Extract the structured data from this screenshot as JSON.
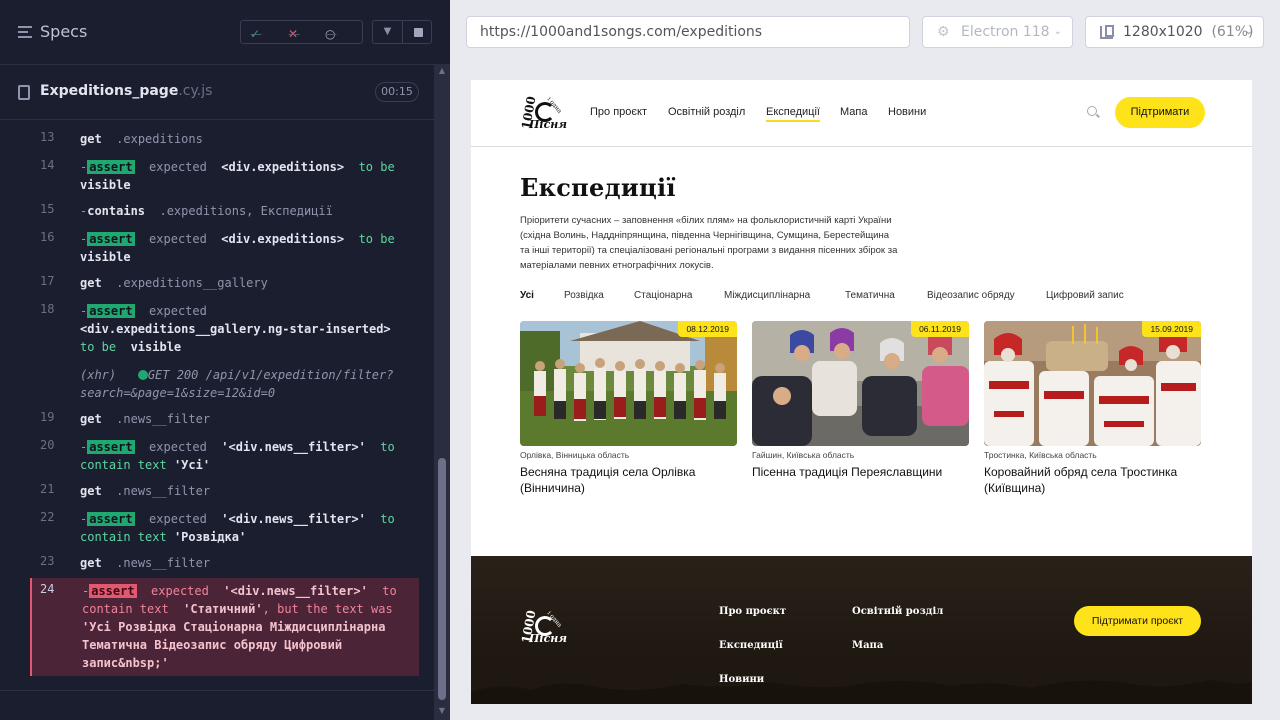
{
  "runner": {
    "specs_title": "Specs",
    "stats": {
      "passed": "✓",
      "failed": "✕",
      "pending": "○",
      "dash": "—"
    },
    "spec_file": {
      "name": "Expeditions_page",
      "ext": ".cy.js",
      "duration": "00:15"
    },
    "commands": [
      {
        "num": "13",
        "parts": [
          "get",
          ".expeditions"
        ]
      },
      {
        "num": "14",
        "badge": "assert",
        "text_a": "expected",
        "subject": "<div.expeditions>",
        "text_b": "to be",
        "value": "visible"
      },
      {
        "num": "15",
        "parts": [
          "contains",
          ".expeditions, Експедиції"
        ]
      },
      {
        "num": "16",
        "badge": "assert",
        "text_a": "expected",
        "subject": "<div.expeditions>",
        "text_b": "to be",
        "value": "visible"
      },
      {
        "num": "17",
        "parts": [
          "get",
          ".expeditions__gallery"
        ]
      },
      {
        "num": "18",
        "badge": "assert",
        "text_a": "expected",
        "subject": "<div.expeditions__gallery.ng-star-inserted>",
        "text_b": "to be",
        "value": "visible"
      },
      {
        "xhr_label": "(xhr)",
        "xhr_text": "GET 200 /api/v1/expedition/filter?search=&page=1&size=12&id=0"
      },
      {
        "num": "19",
        "parts": [
          "get",
          ".news__filter"
        ]
      },
      {
        "num": "20",
        "badge": "assert",
        "text_a": "expected",
        "subject": "'<div.news__filter>'",
        "text_b": "to contain text",
        "value": "'Усі'"
      },
      {
        "num": "21",
        "parts": [
          "get",
          ".news__filter"
        ]
      },
      {
        "num": "22",
        "badge": "assert",
        "text_a": "expected",
        "subject": "'<div.news__filter>'",
        "text_b": "to contain text",
        "value": "'Розвідка'"
      },
      {
        "num": "23",
        "parts": [
          "get",
          ".news__filter"
        ]
      },
      {
        "num": "24",
        "badge": "assert",
        "text_a": "expected",
        "subject": "'<div.news__filter>'",
        "text_b": "to contain text",
        "value": "'Статичний'",
        "text_c": ", but the text was",
        "actual": "'Усі Розвідка Стаціонарна Міждисциплінарна Тематична Відеозапис обряду Цифровий запис&nbsp;'"
      }
    ]
  },
  "browser": {
    "url": "https://1000and1songs.com/expeditions",
    "browser_name": "Electron 118",
    "viewport": "1280x1020",
    "viewport_pct": "(61%)"
  },
  "site": {
    "logo": {
      "top": "1000",
      "arc": "і одна",
      "text": "Пісня"
    },
    "nav": [
      "Про проєкт",
      "Освітній розділ",
      "Експедиції",
      "Мапа",
      "Новини"
    ],
    "support_button": "Підтримати",
    "page_title": "Експедиції",
    "page_description": "Пріоритети сучасних – заповнення «білих плям» на фольклористичній карті України (східна Волинь, Наддніпрянщина, південна Чернігівщина, Сумщина, Берестейщина та інші території) та спеціалізовані регіональні програми з видання пісенних збірок за матеріалами певних етнографічних локусів.",
    "filters": [
      "Усі",
      "Розвідка",
      "Стаціонарна",
      "Міждисциплінарна",
      "Тематична",
      "Відеозапис обряду",
      "Цифровий запис"
    ],
    "cards": [
      {
        "date": "08.12.2019",
        "location": "Орлівка, Вінницька область",
        "title": "Весняна традиція села Орлівка (Вінничина)"
      },
      {
        "date": "06.11.2019",
        "location": "Гайшин, Київська область",
        "title": "Пісенна традиція Переяславщини"
      },
      {
        "date": "15.09.2019",
        "location": "Тростинка, Київська область",
        "title": "Коровайний обряд села Тростинка (Київщина)"
      }
    ],
    "footer": {
      "links": [
        "Про проєкт",
        "Освітній розділ",
        "Експедиції",
        "Мапа",
        "Новини"
      ],
      "button": "Підтримати проєкт"
    }
  },
  "colors": {
    "runner_bg": "#1b1e2e",
    "pass_green": "#1fa971",
    "fail_red": "#e45770",
    "brand_yellow": "#ffe31a",
    "footer_brown": "#221b13"
  },
  "icons": [
    "hamburger-icon",
    "check-icon",
    "x-icon",
    "spinner-icon",
    "chevron-down-icon",
    "stop-icon",
    "file-icon",
    "browser-icon",
    "viewport-icon",
    "search-icon"
  ]
}
